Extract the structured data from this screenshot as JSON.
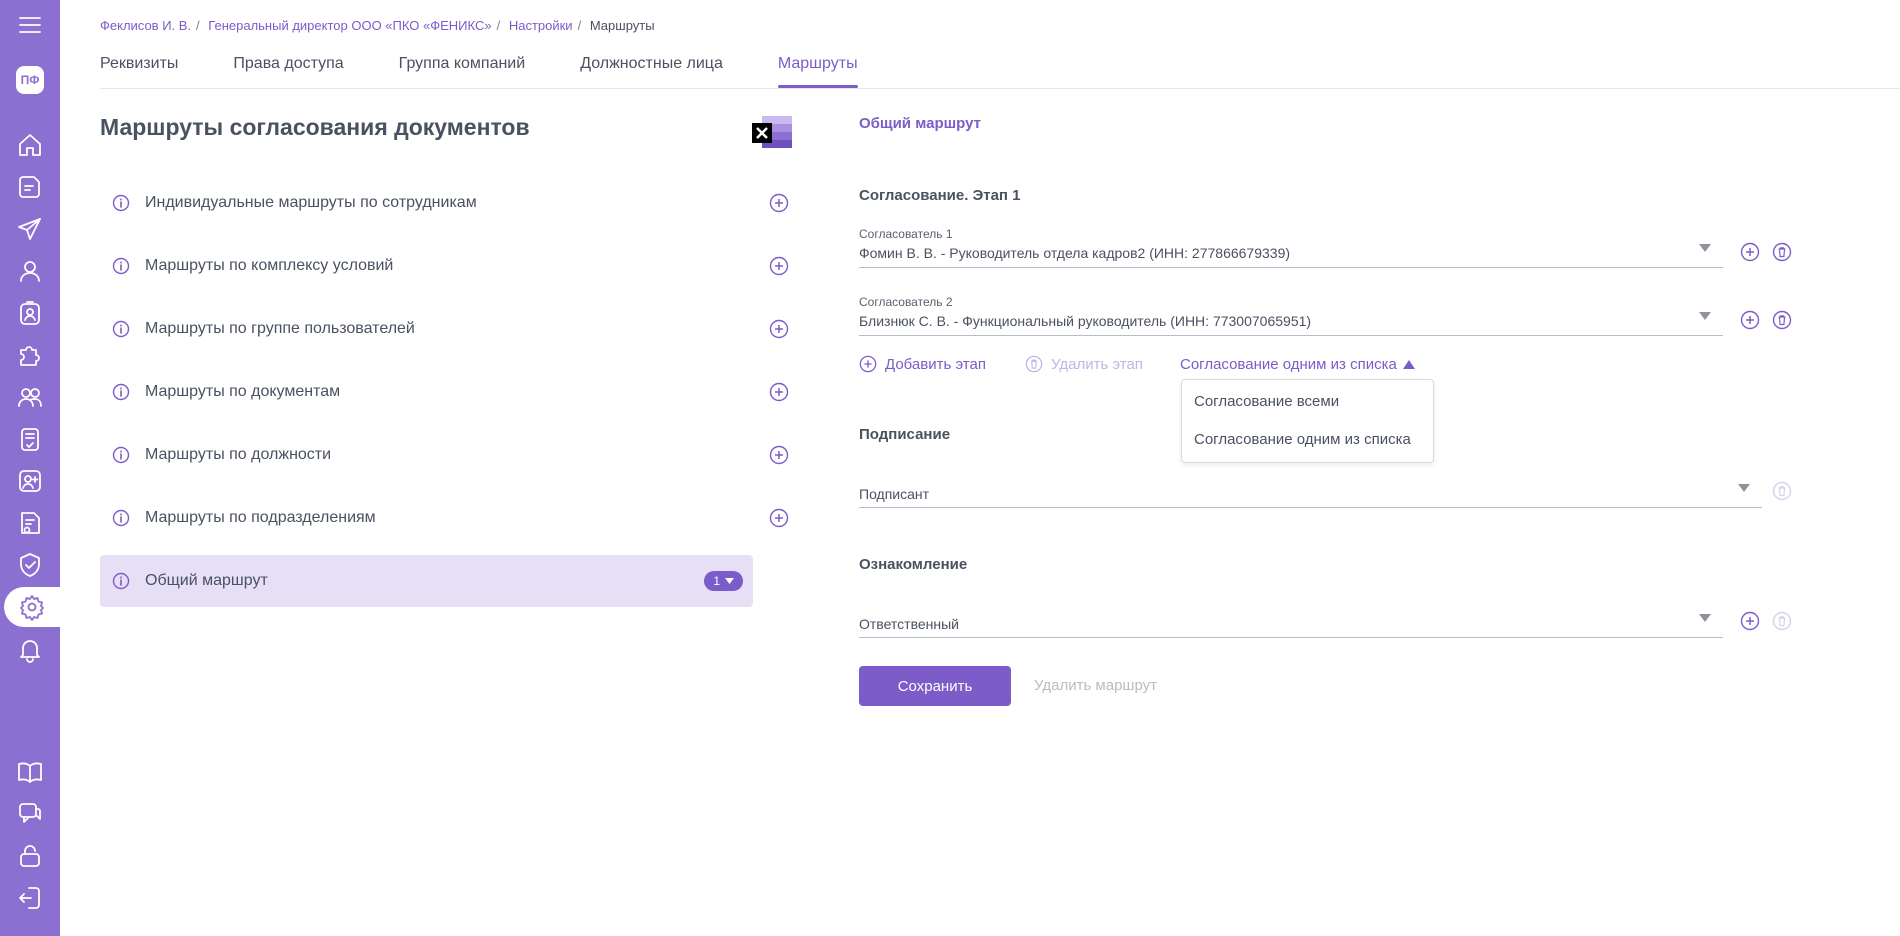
{
  "sidebar": {
    "avatar": "ПФ",
    "items": [
      {
        "name": "menu-icon"
      },
      {
        "name": "home-icon"
      },
      {
        "name": "document-icon"
      },
      {
        "name": "send-icon"
      },
      {
        "name": "user-icon"
      },
      {
        "name": "badge-icon"
      },
      {
        "name": "puzzle-icon"
      },
      {
        "name": "users-icon"
      },
      {
        "name": "notebook-icon"
      },
      {
        "name": "user-plus-icon"
      },
      {
        "name": "certificate-icon"
      },
      {
        "name": "shield-check-icon"
      },
      {
        "name": "gear-icon"
      },
      {
        "name": "bell-icon"
      },
      {
        "name": "book-icon"
      },
      {
        "name": "chat-icon"
      },
      {
        "name": "lock-icon"
      },
      {
        "name": "logout-icon"
      }
    ]
  },
  "breadcrumb": {
    "items": [
      "Феклисов И. В.",
      "Генеральный директор ООО «ПКО «ФЕНИКС»",
      "Настройки"
    ],
    "current": "Маршруты"
  },
  "tabs": [
    {
      "label": "Реквизиты",
      "active": false
    },
    {
      "label": "Права доступа",
      "active": false
    },
    {
      "label": "Группа компаний",
      "active": false
    },
    {
      "label": "Должностные лица",
      "active": false
    },
    {
      "label": "Маршруты",
      "active": true
    }
  ],
  "left": {
    "title": "Маршруты согласования документов",
    "routes": [
      {
        "label": "Индивидуальные маршруты по сотрудникам"
      },
      {
        "label": "Маршруты по комплексу условий"
      },
      {
        "label": "Маршруты по группе пользователей"
      },
      {
        "label": "Маршруты по документам"
      },
      {
        "label": "Маршруты по должности"
      },
      {
        "label": "Маршруты по подразделениям"
      }
    ],
    "general": {
      "label": "Общий маршрут",
      "badge": "1"
    }
  },
  "right": {
    "title": "Общий маршрут",
    "approval": {
      "title": "Согласование. Этап 1",
      "approvers": [
        {
          "label": "Согласователь 1",
          "value": "Фомин В. В. - Руководитель отдела кадров2 (ИНН: 277866679339)"
        },
        {
          "label": "Согласователь 2",
          "value": "Близнюк С. В. - Функциональный руководитель (ИНН: 773007065951)"
        }
      ],
      "add_stage": "Добавить этап",
      "delete_stage": "Удалить этап",
      "mode": "Согласование одним из списка",
      "mode_options": [
        "Согласование всеми",
        "Согласование одним из списка"
      ]
    },
    "signing": {
      "title": "Подписание",
      "placeholder": "Подписант"
    },
    "acquaint": {
      "title": "Ознакомление",
      "placeholder": "Ответственный"
    },
    "save": "Сохранить",
    "delete_route": "Удалить маршрут"
  },
  "colors": {
    "accent": "#7b5cc8",
    "sidebar": "#8b6fd1",
    "selected_row": "#e6dff6"
  }
}
